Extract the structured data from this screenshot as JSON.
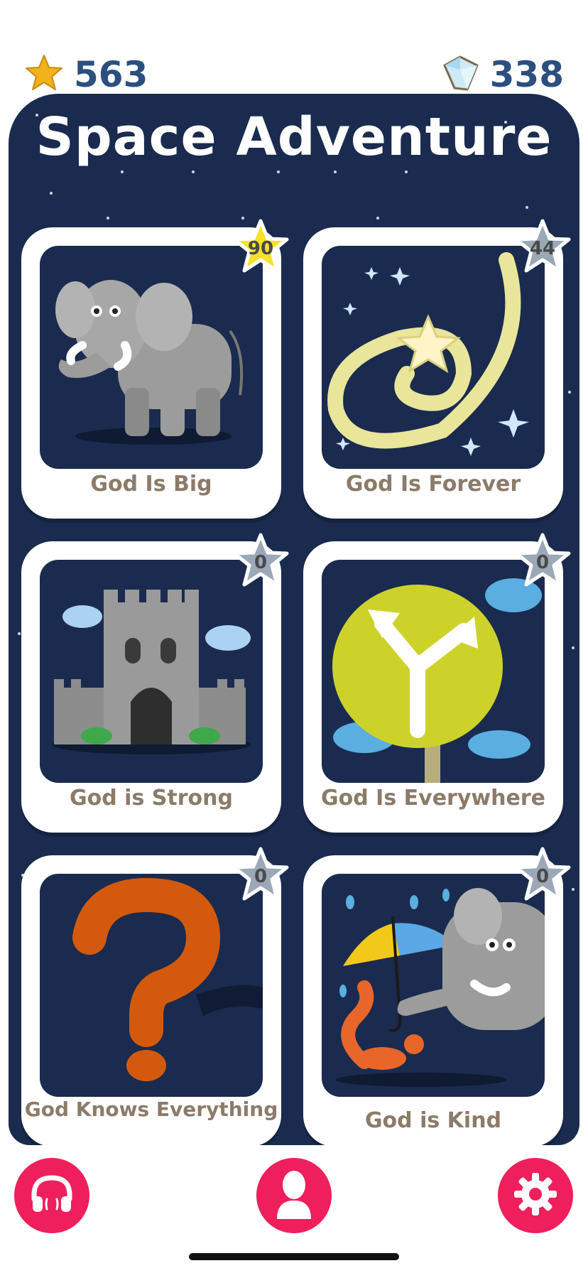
{
  "header": {
    "stars_count": "563",
    "gems_count": "338"
  },
  "panel": {
    "title": "Space Adventure"
  },
  "cards": [
    {
      "label": "God Is Big",
      "score": "90",
      "badge_color": "#f7e12b",
      "art": "elephant-icon"
    },
    {
      "label": "God Is Forever",
      "score": "44",
      "badge_color": "#9aa8b8",
      "art": "galaxy-icon"
    },
    {
      "label": "God is Strong",
      "score": "0",
      "badge_color": "#9aa8b8",
      "art": "castle-icon"
    },
    {
      "label": "God Is Everywhere",
      "score": "0",
      "badge_color": "#9aa8b8",
      "art": "signpost-icon"
    },
    {
      "label": "God Knows Everything",
      "score": "0",
      "badge_color": "#9aa8b8",
      "art": "question-mark-icon"
    },
    {
      "label": "God is Kind",
      "score": "0",
      "badge_color": "#9aa8b8",
      "art": "elephant-umbrella-icon"
    }
  ],
  "bottom_nav": [
    {
      "name": "audio",
      "icon": "headphones-icon"
    },
    {
      "name": "profile",
      "icon": "person-icon"
    },
    {
      "name": "settings",
      "icon": "gear-icon"
    }
  ],
  "colors": {
    "panel_bg": "#1a2b4f",
    "label_text": "#8c7b69",
    "counter_text": "#2b5080",
    "nav_button": "#ee1f5b"
  }
}
